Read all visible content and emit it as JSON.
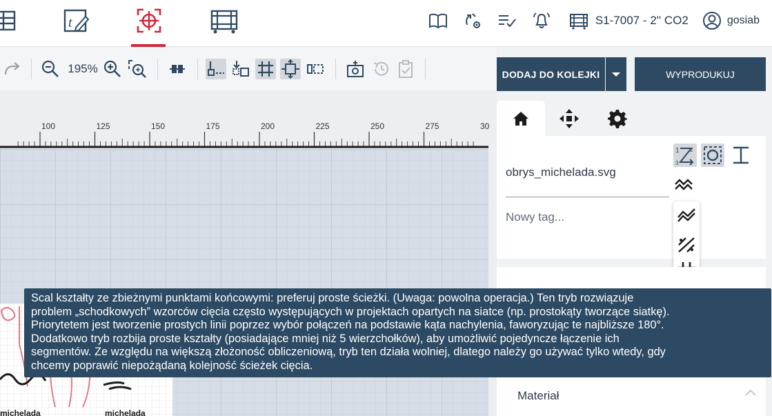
{
  "nav": {
    "icons": [
      "layout-icon",
      "edit-text-icon",
      "target-icon",
      "machine-frame-icon"
    ],
    "active_index": 2,
    "accent_color": "#d0283b"
  },
  "topbar": {
    "machine": "S1-7007 - 2'' CO2",
    "user": "gosiab"
  },
  "toolbar": {
    "zoom": "195%"
  },
  "actions": {
    "queue_label": "DODAJ DO KOLEJKI",
    "produce_label": "WYPRODUKUJ"
  },
  "ruler": {
    "labels": [
      "100",
      "125",
      "150",
      "175",
      "200",
      "225",
      "250",
      "275",
      "30"
    ]
  },
  "panel": {
    "filename": "obrys_michelada.svg",
    "tag_placeholder": "Nowy tag...",
    "material_label": "Materiał"
  },
  "canvas": {
    "shape_labels": [
      "michelada",
      "michelada"
    ]
  },
  "tooltip": {
    "lines": [
      "Scal kształty ze zbieżnymi punktami końcowymi: preferuj proste ścieżki. (Uwaga: powolna operacja.) Ten tryb rozwiązuje",
      "problem „schodkowych” wzorców cięcia często występujących w projektach opartych na siatce (np. prostokąty tworzące siatkę).",
      "Priorytetem jest tworzenie prostych linii poprzez wybór połączeń na podstawie kąta nachylenia, faworyzując te najbliższe 180°.",
      "Dodatkowo tryb rozbija proste kształty (posiadające mniej niż 5 wierzchołków), aby umożliwić pojedyncze łączenie ich",
      "segmentów. Ze względu na większą złożoność obliczeniową, tryb ten działa wolniej, dlatego należy go używać tylko wtedy, gdy",
      "chcemy poprawić niepożądaną kolejność ścieżek cięcia."
    ]
  }
}
